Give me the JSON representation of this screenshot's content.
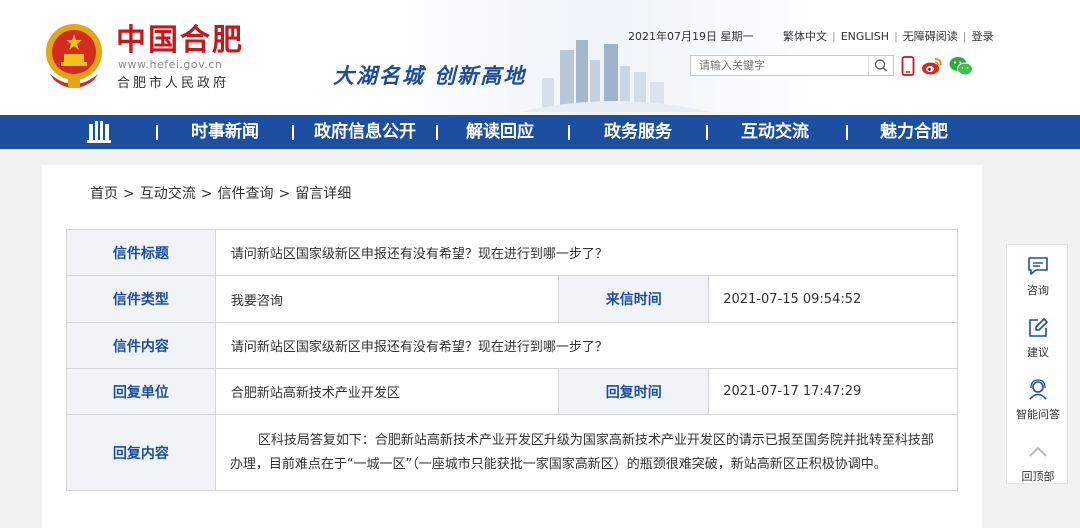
{
  "header": {
    "logo_title": "中国合肥",
    "logo_url": "www.hefei.gov.cn",
    "logo_subtitle": "合肥市人民政府",
    "slogan": "大湖名城  创新高地",
    "date": "2021年07月19日 星期一",
    "links": [
      "繁体中文",
      "ENGLISH",
      "无障碍阅读",
      "登录"
    ],
    "search_placeholder": "请输入关键字",
    "icons": [
      "emblem-icon",
      "search-icon",
      "phone-icon",
      "weibo-icon",
      "wechat-icon"
    ]
  },
  "nav": {
    "items": [
      "时事新闻",
      "政府信息公开",
      "解读回应",
      "政务服务",
      "互动交流",
      "魅力合肥"
    ],
    "accent": "#1c4fa0"
  },
  "breadcrumb": [
    "首页",
    "互动交流",
    "信件查询",
    "留言详细"
  ],
  "letter": {
    "title_label": "信件标题",
    "title_value": "请问新站区国家级新区申报还有没有希望？现在进行到哪一步了？",
    "type_label": "信件类型",
    "type_value": "我要咨询",
    "time_label": "来信时间",
    "time_value": "2021-07-15 09:54:52",
    "content_label": "信件内容",
    "content_value": "请问新站区国家级新区申报还有没有希望？现在进行到哪一步了？",
    "unit_label": "回复单位",
    "unit_value": "合肥新站高新技术产业开发区",
    "reply_time_label": "回复时间",
    "reply_time_value": "2021-07-17 17:47:29",
    "reply_label": "回复内容",
    "reply_value": "区科技局答复如下：合肥新站高新技术产业开发区升级为国家高新技术产业开发区的请示已报至国务院并批转至科技部办理，目前难点在于“一城一区”（一座城市只能获批一家国家高新区）的瓶颈很难突破，新站高新区正积极协调中。"
  },
  "sidebar": {
    "items": [
      "咨询",
      "建议",
      "智能问答",
      "回顶部"
    ]
  }
}
